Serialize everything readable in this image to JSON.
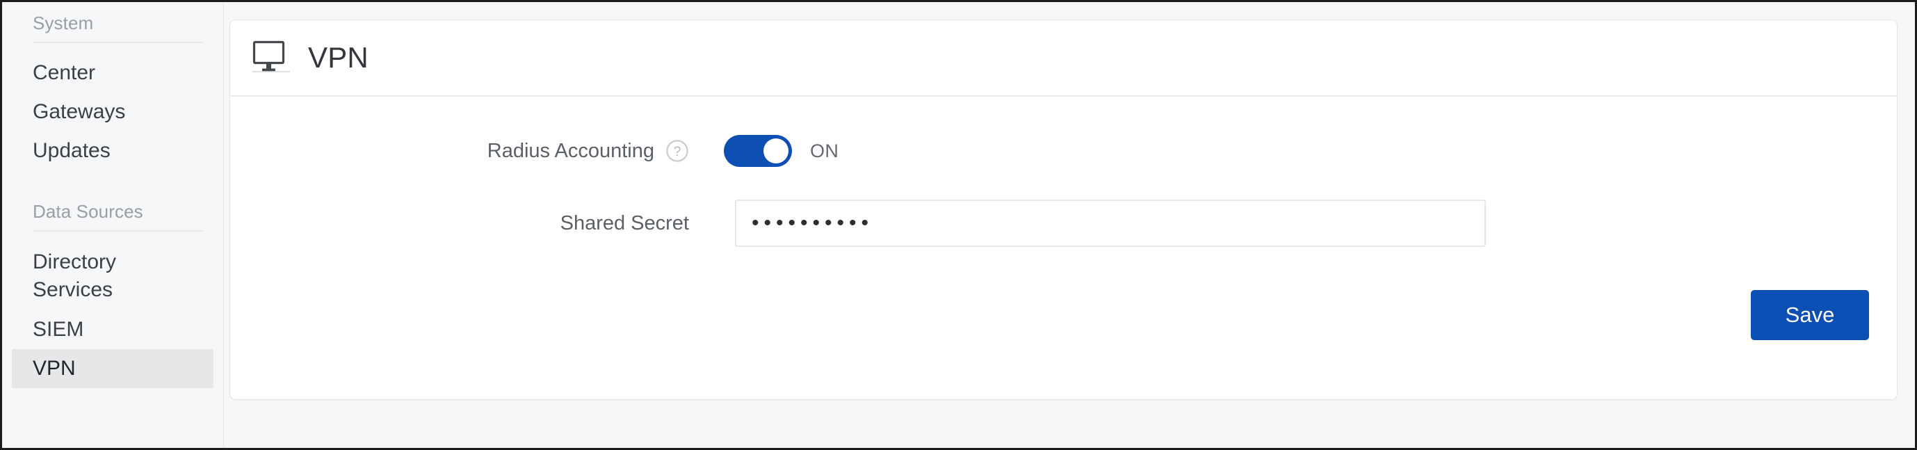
{
  "sidebar": {
    "sections": [
      {
        "header": "System",
        "items": [
          {
            "label": "Center",
            "selected": false
          },
          {
            "label": "Gateways",
            "selected": false
          },
          {
            "label": "Updates",
            "selected": false
          }
        ]
      },
      {
        "header": "Data Sources",
        "items": [
          {
            "label": "Directory\nServices",
            "selected": false
          },
          {
            "label": "SIEM",
            "selected": false
          },
          {
            "label": "VPN",
            "selected": true
          }
        ]
      }
    ]
  },
  "card": {
    "icon": "monitor-icon",
    "title": "VPN",
    "fields": {
      "radius_accounting": {
        "label": "Radius Accounting",
        "help_icon": "help-circle-icon",
        "toggle_state": "on",
        "toggle_label": "ON"
      },
      "shared_secret": {
        "label": "Shared Secret",
        "value": "••••••••••",
        "placeholder": ""
      }
    },
    "save_label": "Save"
  },
  "colors": {
    "accent_blue": "#0b4fb5",
    "toggle_blue": "#0d4fb3",
    "page_background": "#f6f7f8",
    "selected_item": "#e5e7e9",
    "border": "#e4e6e8"
  }
}
